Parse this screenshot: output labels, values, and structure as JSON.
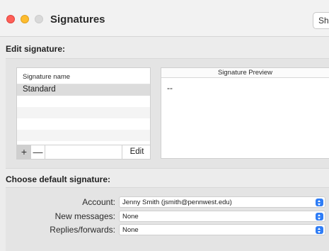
{
  "window": {
    "title": "Signatures",
    "show_button_label": "Sho"
  },
  "edit_section": {
    "heading": "Edit signature:"
  },
  "signature_list": {
    "header": "Signature name",
    "items": [
      "Standard"
    ],
    "add_label": "+",
    "remove_label": "—",
    "edit_label": "Edit"
  },
  "preview": {
    "header": "Signature Preview",
    "body": "--"
  },
  "defaults_section": {
    "heading": "Choose default signature:",
    "fields": [
      {
        "label": "Account:",
        "value": "Jenny Smith (jsmith@pennwest.edu)"
      },
      {
        "label": "New messages:",
        "value": "None"
      },
      {
        "label": "Replies/forwards:",
        "value": "None"
      }
    ]
  },
  "colors": {
    "close": "#fe5f57",
    "minimize": "#febc2e",
    "accent": "#2f7df6"
  }
}
